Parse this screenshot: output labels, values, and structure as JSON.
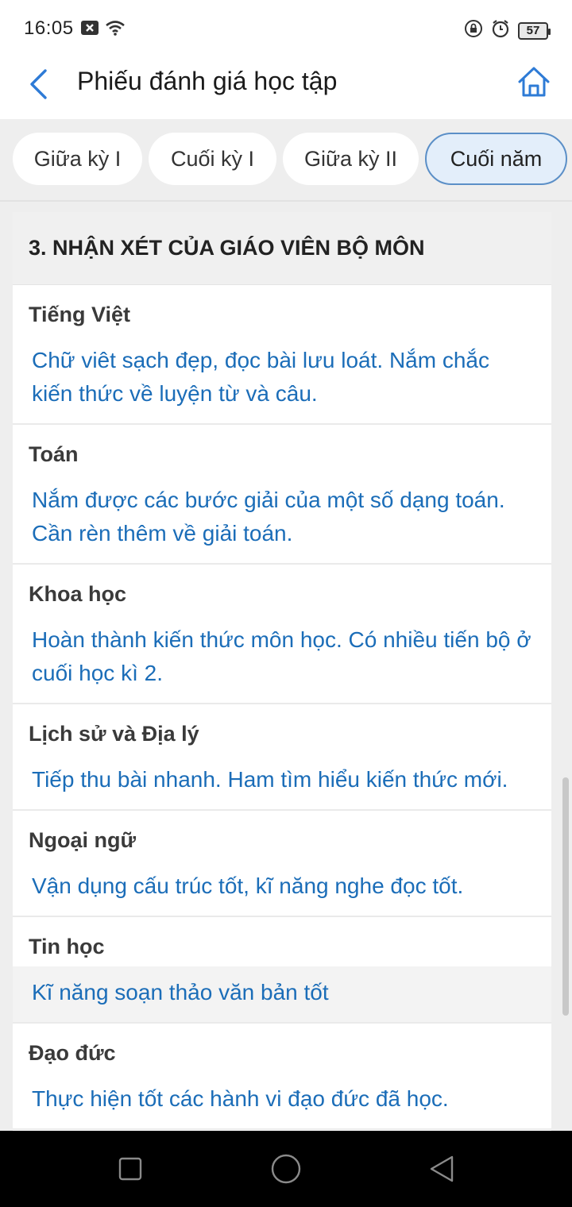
{
  "status_bar": {
    "time": "16:05",
    "battery": "57",
    "icons_left": [
      "notification-x-icon",
      "wifi-icon"
    ],
    "icons_right": [
      "lock-rotation-icon",
      "alarm-icon",
      "battery-icon"
    ]
  },
  "header": {
    "title": "Phiếu đánh giá học tập",
    "back_icon": "back-chevron-icon",
    "home_icon": "home-icon"
  },
  "tabs": [
    {
      "label": "Giữa kỳ I",
      "active": false
    },
    {
      "label": "Cuối kỳ I",
      "active": false
    },
    {
      "label": "Giữa kỳ II",
      "active": false
    },
    {
      "label": "Cuối năm",
      "active": true
    }
  ],
  "section": {
    "title": "3. NHẬN XÉT CỦA GIÁO VIÊN BỘ MÔN",
    "subjects": [
      {
        "name": "Tiếng Việt",
        "comment": "Chữ viêt sạch đẹp, đọc bài lưu loát. Nắm chắc kiến thức về luyện từ và câu."
      },
      {
        "name": "Toán",
        "comment": "Nắm được các bước giải của một số dạng toán. Cần rèn thêm về giải toán."
      },
      {
        "name": "Khoa học",
        "comment": "Hoàn thành kiến thức môn học. Có nhiều tiến bộ ở cuối học kì 2."
      },
      {
        "name": "Lịch sử và Địa lý",
        "comment": "Tiếp thu bài nhanh. Ham tìm hiểu kiến thức mới."
      },
      {
        "name": "Ngoại ngữ",
        "comment": "Vận dụng cấu trúc tốt, kĩ năng nghe đọc tốt."
      },
      {
        "name": "Tin học",
        "comment": "Kĩ năng soạn thảo văn bản tốt"
      },
      {
        "name": "Đạo đức",
        "comment": "Thực hiện tốt các hành vi đạo đức đã học."
      }
    ]
  },
  "nav_bar": {
    "icons": [
      "recent-apps-icon",
      "home-circle-icon",
      "back-triangle-icon"
    ]
  },
  "colors": {
    "accent": "#1b6db8",
    "active_tab_bg": "#e3eefa",
    "active_tab_border": "#5b8fc7"
  }
}
